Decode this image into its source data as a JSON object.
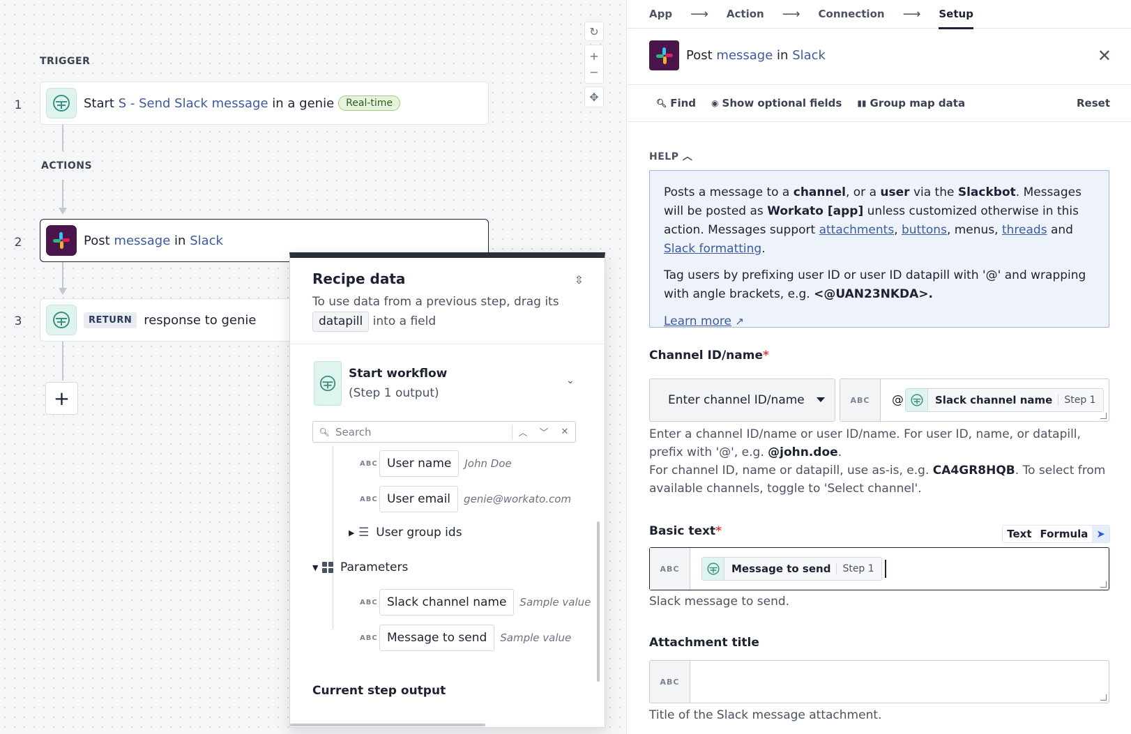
{
  "canvas": {
    "trigger_label": "TRIGGER",
    "actions_label": "ACTIONS",
    "steps": [
      {
        "num": "1",
        "prefix": "Start",
        "link": "S - Send Slack message",
        "suffix": "in a genie",
        "badge": "Real-time"
      },
      {
        "num": "2",
        "prefix": "Post",
        "link": "message",
        "mid": "in",
        "link2": "Slack"
      },
      {
        "num": "3",
        "badge": "RETURN",
        "text": "response to genie"
      }
    ],
    "add_step_icon": "+",
    "zoom_controls": [
      "reset-icon",
      "zoom-in-icon",
      "zoom-out-icon",
      "fit-icon"
    ]
  },
  "recipe_data": {
    "title": "Recipe data",
    "desc_before": "To use data from a previous step, drag its",
    "desc_pill": "datapill",
    "desc_after": "into a field",
    "start_workflow_title": "Start workflow",
    "start_workflow_sub": "(Step 1 output)",
    "search_placeholder": "Search",
    "fields": [
      {
        "type": "ABC",
        "name": "User name",
        "sample": "John Doe"
      },
      {
        "type": "ABC",
        "name": "User email",
        "sample": "genie@workato.com"
      }
    ],
    "user_group_ids": "User group ids",
    "parameters_label": "Parameters",
    "parameters": [
      {
        "type": "ABC",
        "name": "Slack channel name",
        "sample": "Sample value"
      },
      {
        "type": "ABC",
        "name": "Message to send",
        "sample": "Sample value"
      }
    ],
    "current_step_output": "Current step output"
  },
  "panel": {
    "wizard": [
      "App",
      "Action",
      "Connection",
      "Setup"
    ],
    "wizard_active": "Setup",
    "wizard_arrow": "⟶",
    "title_prefix": "Post",
    "title_link1": "message",
    "title_mid": "in",
    "title_link2": "Slack",
    "toolbar": {
      "find": "Find",
      "optional": "Show optional fields",
      "group": "Group map data",
      "reset": "Reset"
    },
    "help_label": "HELP",
    "help": {
      "p1_a": "Posts a message to a ",
      "p1_channel": "channel",
      "p1_b": ", or a ",
      "p1_user": "user",
      "p1_c": " via the ",
      "p1_slackbot": "Slackbot",
      "p1_d": ". Messages will be posted as ",
      "p1_workato": "Workato [app]",
      "p1_e": " unless customized otherwise in this action. Messages support ",
      "link_attachments": "attachments",
      "comma1": ", ",
      "link_buttons": "buttons",
      "p1_f": ", menus, ",
      "link_threads": "threads",
      "p1_g": " and ",
      "link_formatting": "Slack formatting",
      "p1_h": ".",
      "p2": "Tag users by prefixing user ID or user ID datapill with '@' and wrapping with angle brackets, e.g. ",
      "p2_code": "<@UAN23NKDA>.",
      "learn_more": "Learn more"
    },
    "channel": {
      "label": "Channel ID/name",
      "select_value": "Enter channel ID/name",
      "type_tag": "ABC",
      "at": "@",
      "pill_name": "Slack channel name",
      "pill_step": "Step 1",
      "desc_1": "Enter a channel ID/name or user ID/name. For user ID, name, or datapill, prefix with '@', e.g. ",
      "desc_1_code": "@john.doe",
      "desc_1_end": ".",
      "desc_2": "For channel ID, name or datapill, use as-is, e.g. ",
      "desc_2_code": "CA4GR8HQB",
      "desc_2_end": ". To select from available channels, toggle to 'Select channel'."
    },
    "basic_text": {
      "label": "Basic text",
      "mode_text": "Text",
      "mode_formula": "Formula",
      "type_tag": "ABC",
      "pill_name": "Message to send",
      "pill_step": "Step 1",
      "desc": "Slack message to send."
    },
    "attachment_title": {
      "label": "Attachment title",
      "type_tag": "ABC",
      "desc": "Title of the Slack message attachment."
    },
    "required_mark": "*"
  },
  "colors": {
    "accent_link": "#3d5a9e",
    "slack_purple": "#4a154b",
    "help_bg": "#eef3fb",
    "required": "#d64545"
  }
}
